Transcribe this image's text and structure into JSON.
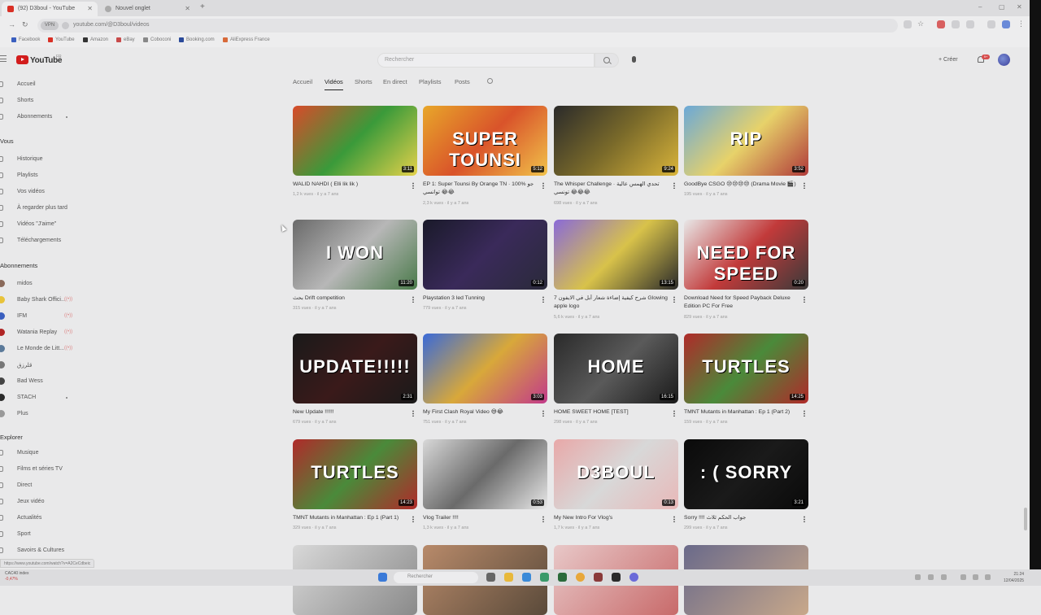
{
  "browser": {
    "tabs": [
      {
        "label": "(92) D3boul - YouTube",
        "active": true,
        "color": "#d93025"
      },
      {
        "label": "Nouvel onglet",
        "active": false,
        "color": "#888888"
      }
    ],
    "url": "youtube.com/@D3boul/videos",
    "vpn_label": "VPN",
    "bookmarks": [
      "Facebook",
      "YouTube",
      "Amazon",
      "eBay",
      "Coboconi",
      "Booking.com",
      "AliExpress France"
    ]
  },
  "youtube": {
    "logo_text": "YouTube",
    "logo_region": "FR",
    "search_placeholder": "Rechercher",
    "create_label": "Créer",
    "notif_count": "9+"
  },
  "sidebar": {
    "main": [
      "Accueil",
      "Shorts",
      "Abonnements"
    ],
    "you_header": "Vous",
    "you": [
      "Historique",
      "Playlists",
      "Vos vidéos",
      "À regarder plus tard",
      "Vidéos \"J'aime\"",
      "Téléchargements"
    ],
    "subs_header": "Abonnements",
    "subs": [
      {
        "name": "midos",
        "live": false,
        "color": "#8a6a5a"
      },
      {
        "name": "Baby Shark Offici...",
        "live": true,
        "color": "#e8c33a"
      },
      {
        "name": "IFM",
        "live": true,
        "color": "#3a5fbf"
      },
      {
        "name": "Watania Replay",
        "live": true,
        "color": "#b02424"
      },
      {
        "name": "Le Monde de Litt...",
        "live": true,
        "color": "#5b7a9a"
      },
      {
        "name": "قلرزق",
        "live": false,
        "color": "#777777"
      },
      {
        "name": "Bad Wess",
        "live": false,
        "color": "#444444"
      },
      {
        "name": "STACH",
        "live": false,
        "color": "#2a2a2a"
      },
      {
        "name": "Plus",
        "live": false,
        "color": "#999999"
      }
    ],
    "explore_header": "Explorer",
    "explore": [
      "Musique",
      "Films et séries TV",
      "Direct",
      "Jeux vidéo",
      "Actualités",
      "Sport",
      "Savoirs & Cultures"
    ]
  },
  "channel_tabs": [
    "Accueil",
    "Vidéos",
    "Shorts",
    "En direct",
    "Playlists",
    "Posts"
  ],
  "selected_tab": "Vidéos",
  "videos": [
    {
      "title": "WALID NAHDI ( Elli lik lik )",
      "meta": "1,2 k vues · il y a 7 ans",
      "duration": "3:11",
      "bg": "linear-gradient(135deg,#d94a2a,#3a9a3a,#e4d14a)",
      "overlay": ""
    },
    {
      "title": "EP 1: Super Tounsi By Orange TN · 100% جو توانسي 😂😂",
      "meta": "2,3 k vues · il y a 7 ans",
      "duration": "5:12",
      "bg": "linear-gradient(135deg,#e8a72a,#d9532a,#f1c24a)",
      "overlay": "SUPER TOUNSI"
    },
    {
      "title": "The Whisper Challenge · تحدي الهمس عالية تونسي 😂😂😂",
      "meta": "698 vues · il y a 7 ans",
      "duration": "9:24",
      "bg": "linear-gradient(135deg,#2a2a2a,#7a6a2a,#d9b43a)",
      "overlay": ""
    },
    {
      "title": "GoodBye CSGO 😢😢😢😢 (Drama Movie 🎬)",
      "meta": "195 vues · il y a 7 ans",
      "duration": "3:52",
      "bg": "linear-gradient(135deg,#6aa8d8,#e7d26a,#b03a3a)",
      "overlay": "RIP"
    },
    {
      "title": "بحث Drift competition",
      "meta": "315 vues · il y a 7 ans",
      "duration": "11:20",
      "bg": "linear-gradient(135deg,#6a6a6a,#b7b7b7,#4a7a4a)",
      "overlay": "I WON"
    },
    {
      "title": "Playstation 3 led Tunning",
      "meta": "779 vues · il y a 7 ans",
      "duration": "0:12",
      "bg": "linear-gradient(135deg,#1a1a2a,#3a2a5a,#2a2a3a)",
      "overlay": ""
    },
    {
      "title": "7 شرح كيفية إضاءة شعار أبل في الايفون Glowing apple logo",
      "meta": "5,6 k vues · il y a 7 ans",
      "duration": "13:15",
      "bg": "linear-gradient(135deg,#8a6ad8,#d8c24a,#2a2a2a)",
      "overlay": ""
    },
    {
      "title": "Download Need for Speed Payback Deluxe Edition PC For Free",
      "meta": "829 vues · il y a 7 ans",
      "duration": "0:20",
      "bg": "linear-gradient(135deg,#e8e8e8,#c23a3a,#3a3a3a)",
      "overlay": "NEED FOR SPEED"
    },
    {
      "title": "New Update !!!!!!",
      "meta": "679 vues · il y a 7 ans",
      "duration": "2:31",
      "bg": "linear-gradient(135deg,#1a1a1a,#3a1a1a,#1a1a1a)",
      "overlay": "UPDATE!!!!!"
    },
    {
      "title": "My First Clash Royal Video 😅😂",
      "meta": "751 vues · il y a 7 ans",
      "duration": "3:03",
      "bg": "linear-gradient(135deg,#3a6ad8,#d8a83a,#c23a8a)",
      "overlay": ""
    },
    {
      "title": "HOME SWEET HOME [TEST]",
      "meta": "298 vues · il y a 7 ans",
      "duration": "16:15",
      "bg": "linear-gradient(135deg,#2a2a2a,#5a5a5a,#1a1a1a)",
      "overlay": "HOME"
    },
    {
      "title": "TMNT Mutants in Manhattan : Ep 1 (Part 2)",
      "meta": "159 vues · il y a 7 ans",
      "duration": "14:25",
      "bg": "linear-gradient(135deg,#b02a2a,#4a8a3a,#b02a2a)",
      "overlay": "TURTLES"
    },
    {
      "title": "TMNT Mutants in Manhattan : Ep 1 (Part 1)",
      "meta": "329 vues · il y a 7 ans",
      "duration": "14:23",
      "bg": "linear-gradient(135deg,#b02a2a,#4a8a3a,#b02a2a)",
      "overlay": "TURTLES"
    },
    {
      "title": "Vlog Trailer !!!!",
      "meta": "1,3 k vues · il y a 7 ans",
      "duration": "0:53",
      "bg": "linear-gradient(135deg,#d8d8d8,#6a6a6a,#e8e8e8)",
      "overlay": ""
    },
    {
      "title": "My New Intro For Vlog's",
      "meta": "1,7 k vues · il y a 7 ans",
      "duration": "0:13",
      "bg": "linear-gradient(135deg,#e8a8a8,#d8d8d8,#e8b8b8)",
      "overlay": "D3BOUL"
    },
    {
      "title": "Sorry !!!! جواب الحكم ثلاث",
      "meta": "299 vues · il y a 7 ans",
      "duration": "3:21",
      "bg": "linear-gradient(135deg,#0a0a0a,#1a1a1a,#0a0a0a)",
      "overlay": ": ( SORRY"
    },
    {
      "title": "",
      "meta": "",
      "duration": "",
      "bg": "linear-gradient(135deg,#d8d8d8,#8a8a8a)",
      "overlay": ""
    },
    {
      "title": "",
      "meta": "",
      "duration": "",
      "bg": "linear-gradient(135deg,#b88a6a,#5a4a3a)",
      "overlay": ""
    },
    {
      "title": "",
      "meta": "",
      "duration": "",
      "bg": "linear-gradient(135deg,#e8c8c8,#c86a6a)",
      "overlay": ""
    },
    {
      "title": "",
      "meta": "",
      "duration": "",
      "bg": "linear-gradient(135deg,#6a6a8a,#c8a88a)",
      "overlay": ""
    }
  ],
  "status_url": "https://www.youtube.com/watch?v=A2CeCdbeic",
  "taskbar": {
    "search": "Rechercher",
    "weather_label": "CAC40 index",
    "weather_value": "-0,47%",
    "time": "21:24",
    "date": "12/04/2025"
  }
}
